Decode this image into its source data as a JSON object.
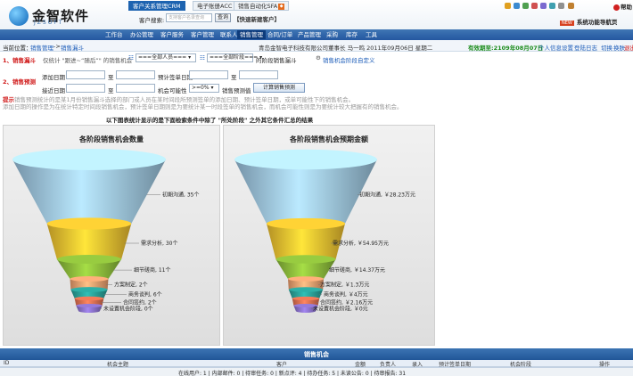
{
  "header": {
    "logo_cn": "金智软件",
    "logo_en": "JZSOFT",
    "tabs": [
      {
        "label": "客户关系管理CRM",
        "active": true
      },
      {
        "label": "电子账册ACC",
        "active": false
      },
      {
        "label": "销售自动化SFA",
        "active": false
      }
    ],
    "search_label": "客户搜索:",
    "search_placeholder": "支持客户名录查询",
    "search_button": "查询",
    "quick_add": "【快速新建客户】",
    "toolbar_icons": [
      "home-icon",
      "folder-icon",
      "chart-icon",
      "mail-icon",
      "calendar-icon",
      "user-icon",
      "settings-icon",
      "lock-icon"
    ],
    "help": "帮助",
    "nav_guide_badge": "NEW",
    "nav_guide": "系统功能导航页"
  },
  "mainnav": [
    "工作台",
    "办公管理",
    "客户服务",
    "客户管理",
    "联系人",
    "销售管理",
    "合同/订单",
    "产品管理",
    "采购",
    "库存",
    "工具"
  ],
  "mainnav_active": 5,
  "breadcrumb": {
    "prefix": "当前位置：",
    "path1": "销售管理",
    "sep": "->",
    "path2": "销售漏斗",
    "welcome": "青岛金智电子科技有限公司董事长  马一鸣  2011年09月06日 星期二",
    "online": "有效期至:2109年08月07日",
    "links": [
      "个人信息设置",
      "登陆日志",
      "切换",
      "换肤",
      "退出"
    ]
  },
  "filter1": {
    "label": "1、销售漏斗",
    "desc": "仅统计 \"跟进~“随后”\" 的销售机会",
    "user_select": "===全部人员===",
    "stage_select": "===全部阶段===",
    "after": "的阶段销售漏斗",
    "custom_link": "销售机会阶段自定义"
  },
  "filter2": {
    "label": "2、销售预测",
    "add_date": "添加日期",
    "to": "至",
    "follow_date": "接近日期",
    "est_date": "预计签单日期",
    "prob": "机会可能性",
    "prob_value": ">=0%",
    "forecast_label": "销售预测值",
    "button": "计算销售预测"
  },
  "hints": {
    "kw": "提示",
    "line1": "销售预测统计的是某1月份销售漏斗选择的部门或人员在某时间段所预测签单的添加日期、预计签单日期，或单可能性下的销售机会。",
    "line2": "添加日期的操作是为在统计特定时间段销售机会，预计签单日期则是为要统计某一时段签单的销售机会，而机会可能性则是为要统计较大把握有的销售机会。"
  },
  "chart_caption": "以下图表统计显示的是下面检索条件中除了 \"所处阶段\" 之外其它条件汇总的结果",
  "chart_data": [
    {
      "type": "funnel",
      "title": "各阶段销售机会数量",
      "categories": [
        "初期沟通",
        "需求分析",
        "细节磋商",
        "方案制定",
        "商务谈判",
        "合同签约",
        "未设置机会阶段"
      ],
      "values": [
        35,
        30,
        11,
        2,
        6,
        2,
        0
      ],
      "labels": [
        "初期沟通, 35个",
        "需求分析, 30个",
        "细节磋商, 11个",
        "方案制定, 2个",
        "商务谈判, 6个",
        "合同签约, 2个",
        "未设置机会阶段, 0个"
      ],
      "colors": [
        "#9cc3de",
        "#f0c030",
        "#8ab93a",
        "#f0a070",
        "#2aa098",
        "#e07050",
        "#8870c8"
      ]
    },
    {
      "type": "funnel",
      "title": "各阶段销售机会预期金额",
      "categories": [
        "初期沟通",
        "需求分析",
        "细节磋商",
        "方案制定",
        "商务谈判",
        "合同签约",
        "未设置机会阶段"
      ],
      "values": [
        28.23,
        54.95,
        14.37,
        1.37,
        4,
        2.16,
        0
      ],
      "unit": "万元",
      "labels": [
        "初期沟通, ￥28.23万元",
        "需求分析, ￥54.95万元",
        "细节磋商, ￥14.37万元",
        "方案制定, ￥1.3万元",
        "商务谈判, ￥4万元",
        "合同签约, ￥2.16万元",
        "未设置机会阶段, ￥0元"
      ],
      "colors": [
        "#9cc3de",
        "#f0c030",
        "#8ab93a",
        "#f0a070",
        "#2aa098",
        "#e07050",
        "#8870c8"
      ]
    }
  ],
  "section_title": "销售机会",
  "table_headers": [
    "ID",
    "机会主题",
    "客户",
    "金额",
    "负责人",
    "录入",
    "预计签单日期",
    "机会阶段",
    "操作"
  ],
  "status": {
    "text": "在线用户: 1 | 内部邮件: 0 | 待审任务: 0 | 新点评: 4 | 待办任务: 5 | 未读公告: 0 | 待审报告: 31"
  }
}
